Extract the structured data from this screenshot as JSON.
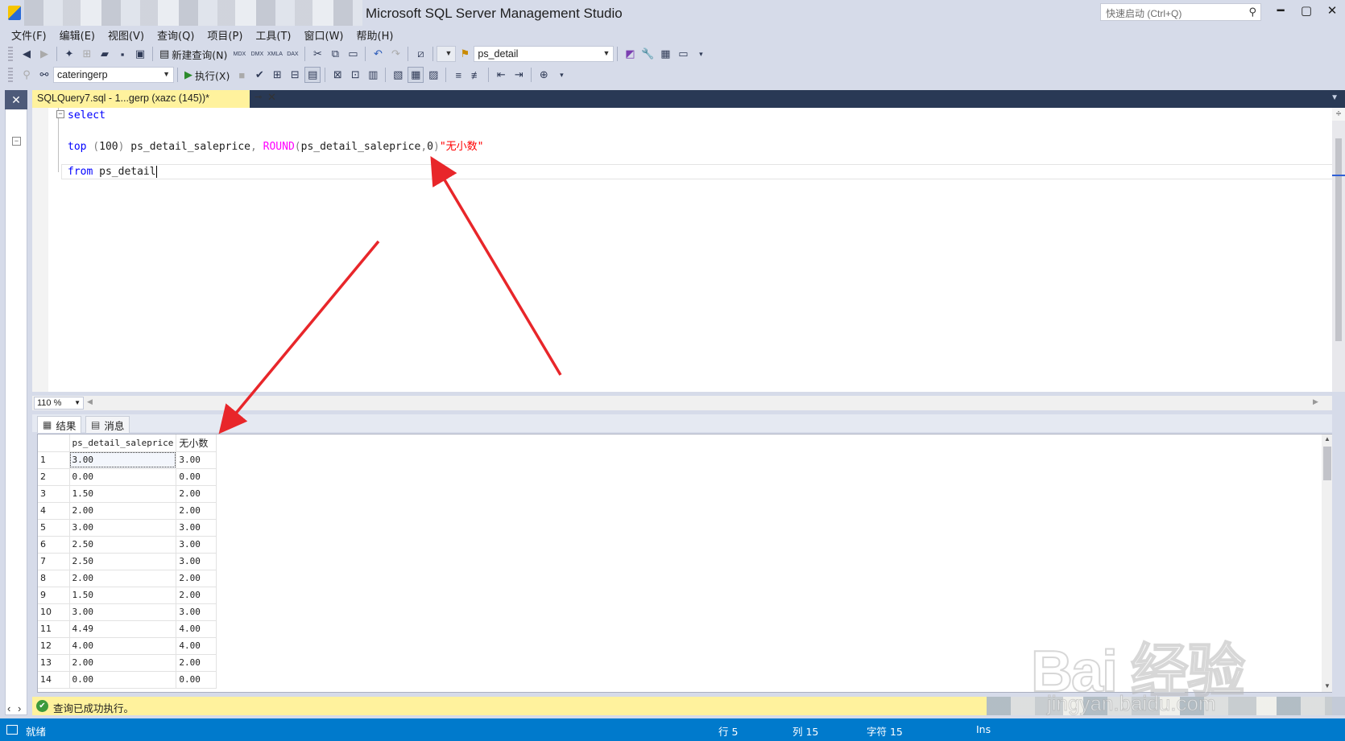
{
  "window": {
    "title": "Microsoft SQL Server Management Studio",
    "quick_launch_placeholder": "快速启动 (Ctrl+Q)",
    "minimize": "━",
    "maximize": "▢",
    "close": "✕"
  },
  "menu": [
    "文件(F)",
    "编辑(E)",
    "视图(V)",
    "查询(Q)",
    "项目(P)",
    "工具(T)",
    "窗口(W)",
    "帮助(H)"
  ],
  "toolbar": {
    "new_query_label": "新建查询(N)",
    "object_combo": "ps_detail",
    "database_combo": "cateringerp",
    "execute_label": "执行(X)",
    "icon_labels": [
      "MDX",
      "DMX",
      "XMLA",
      "DAX"
    ]
  },
  "document": {
    "tab_title": "SQLQuery7.sql - 1...gerp (xazc (145))*",
    "pin": "⊸",
    "close": "✕"
  },
  "editor": {
    "line1_keyword": "select",
    "line3": {
      "kw_top": "top",
      "paren_open": " (",
      "num": "100",
      "paren_close": ") ",
      "col": "ps_detail_saleprice",
      "comma": ", ",
      "fn": "ROUND",
      "args_open": "(",
      "arg_col": "ps_detail_saleprice",
      "arg_sep": ",",
      "arg_num": "0",
      "args_close": ")",
      "alias": "\"无小数\""
    },
    "line5": {
      "kw_from": "from",
      "table": " ps_detail"
    }
  },
  "zoom": "110 %",
  "results_tabs": {
    "results": "结果",
    "messages": "消息"
  },
  "grid": {
    "columns": [
      "ps_detail_saleprice",
      "无小数"
    ],
    "rows": [
      [
        "1",
        "3.00",
        "3.00"
      ],
      [
        "2",
        "0.00",
        "0.00"
      ],
      [
        "3",
        "1.50",
        "2.00"
      ],
      [
        "4",
        "2.00",
        "2.00"
      ],
      [
        "5",
        "3.00",
        "3.00"
      ],
      [
        "6",
        "2.50",
        "3.00"
      ],
      [
        "7",
        "2.50",
        "3.00"
      ],
      [
        "8",
        "2.00",
        "2.00"
      ],
      [
        "9",
        "1.50",
        "2.00"
      ],
      [
        "10",
        "3.00",
        "3.00"
      ],
      [
        "11",
        "4.49",
        "4.00"
      ],
      [
        "12",
        "4.00",
        "4.00"
      ],
      [
        "13",
        "2.00",
        "2.00"
      ],
      [
        "14",
        "0.00",
        "0.00"
      ]
    ]
  },
  "query_status": "查询已成功执行。",
  "status_bar": {
    "ready": "就绪",
    "row": "行 5",
    "col": "列 15",
    "char": "字符 15",
    "ins": "Ins"
  },
  "watermark": {
    "main": "Bai 经验",
    "sub": "jingyan.baidu.com"
  },
  "colors": {
    "status_bar": "#007acc",
    "doc_tab": "#fff29d",
    "keyword": "#0000ff",
    "function": "#ff00ff",
    "string": "#ff0000",
    "annotation_arrow": "#e8262a"
  }
}
